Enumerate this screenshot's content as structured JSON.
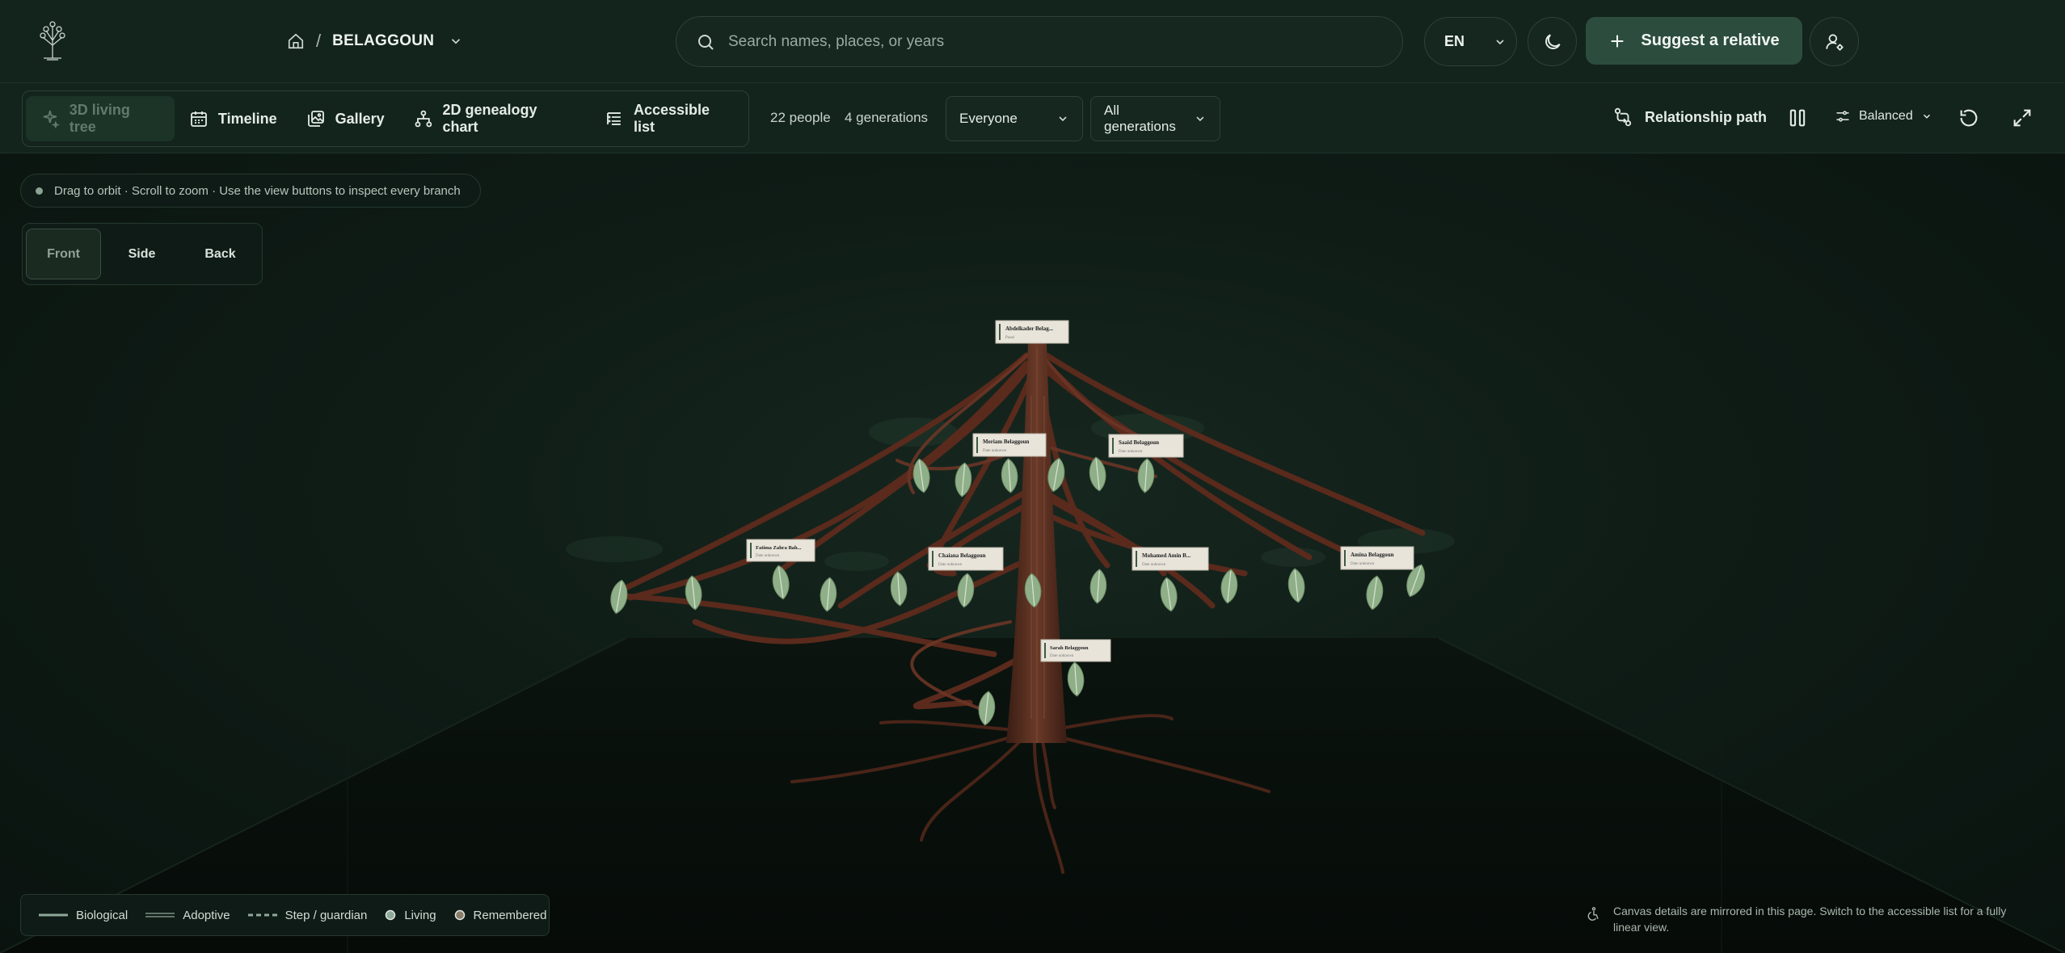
{
  "header": {
    "family_name": "BELAGGOUN",
    "breadcrumb_separator": "/",
    "search_placeholder": "Search names, places, or years",
    "language": "EN",
    "suggest_label": "Suggest a relative"
  },
  "toolbar": {
    "views": [
      {
        "label": "3D living tree",
        "icon": "tree-sparkle-icon",
        "active": true
      },
      {
        "label": "Timeline",
        "icon": "calendar-icon",
        "active": false
      },
      {
        "label": "Gallery",
        "icon": "gallery-icon",
        "active": false
      },
      {
        "label": "2D genealogy chart",
        "icon": "org-chart-icon",
        "active": false
      },
      {
        "label": "Accessible list",
        "icon": "list-icon",
        "active": false
      }
    ],
    "people_count": "22 people",
    "generation_count": "4 generations",
    "people_filter": "Everyone",
    "generation_filter": "All generations",
    "relationship_path_label": "Relationship path",
    "quality_label": "Balanced"
  },
  "stage": {
    "hint": "Drag to orbit · Scroll to zoom · Use the view buttons to inspect every branch",
    "camera_views": [
      {
        "label": "Front",
        "active": true
      },
      {
        "label": "Side",
        "active": false
      },
      {
        "label": "Back",
        "active": false
      }
    ]
  },
  "tree_cards": [
    {
      "name": "Abdelkader Belag...",
      "sub": "Passé"
    },
    {
      "name": "Meriam Belaggoun",
      "sub": "Date unknown"
    },
    {
      "name": "Saaid Belaggoun",
      "sub": "Date unknown"
    },
    {
      "name": "Fatima Zahra Bah...",
      "sub": "Date unknown"
    },
    {
      "name": "Chaiana Belaggoun",
      "sub": "Date unknown"
    },
    {
      "name": "Mohamed Amin B...",
      "sub": "Date unknown"
    },
    {
      "name": "Amina Belaggoun",
      "sub": "Date unknown"
    },
    {
      "name": "Sarah Belaggoun",
      "sub": "Date unknown"
    }
  ],
  "legend": {
    "biological": "Biological",
    "adoptive": "Adoptive",
    "step": "Step / guardian",
    "living": "Living",
    "remembered": "Remembered"
  },
  "footer_note": "Canvas details are mirrored in this page. Switch to the accessible list for a fully linear view.",
  "colors": {
    "background": "#0f1a15",
    "header": "#13241c",
    "accent_button": "#2c4d3d",
    "branch": "#5a2a1c",
    "leaf": "#8faf88",
    "card": "#e8e4da"
  }
}
